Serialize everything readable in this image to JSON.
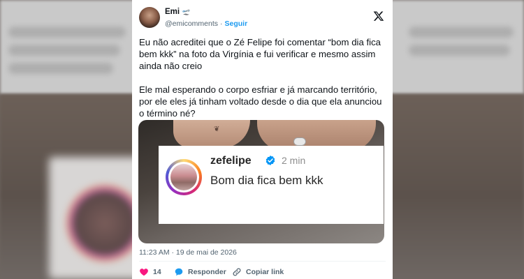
{
  "tweet": {
    "author": {
      "name": "Emi",
      "name_emoji": "🛫",
      "handle": "@emicomments",
      "follow_label": "Seguir"
    },
    "text": "Eu não acreditei que o Zé Felipe foi comentar “bom dia fica bem kkk” na foto da Virgínia e fui verificar e mesmo assim ainda não creio\n\nEle mal esperando o corpo esfriar e já marcando território, por ele eles já tinham voltado desde o dia que ela anunciou o término né?",
    "embedded_comment": {
      "username": "zefelipe",
      "time": "2 min",
      "comment": "Bom dia fica bem kkk"
    },
    "timestamp": "11:23 AM · 19 de mai de 2026",
    "actions": {
      "likes": "14",
      "reply_label": "Responder",
      "copy_link_label": "Copiar link"
    }
  },
  "icons": {
    "platform_logo": "x-logo-icon",
    "verified": "verified-badge-icon",
    "like": "heart-icon",
    "reply": "speech-bubble-icon",
    "copy": "link-icon"
  },
  "colors": {
    "like": "#f91880",
    "reply": "#1d9bf0",
    "follow": "#1d9bf0",
    "verified": "#0095f6"
  }
}
